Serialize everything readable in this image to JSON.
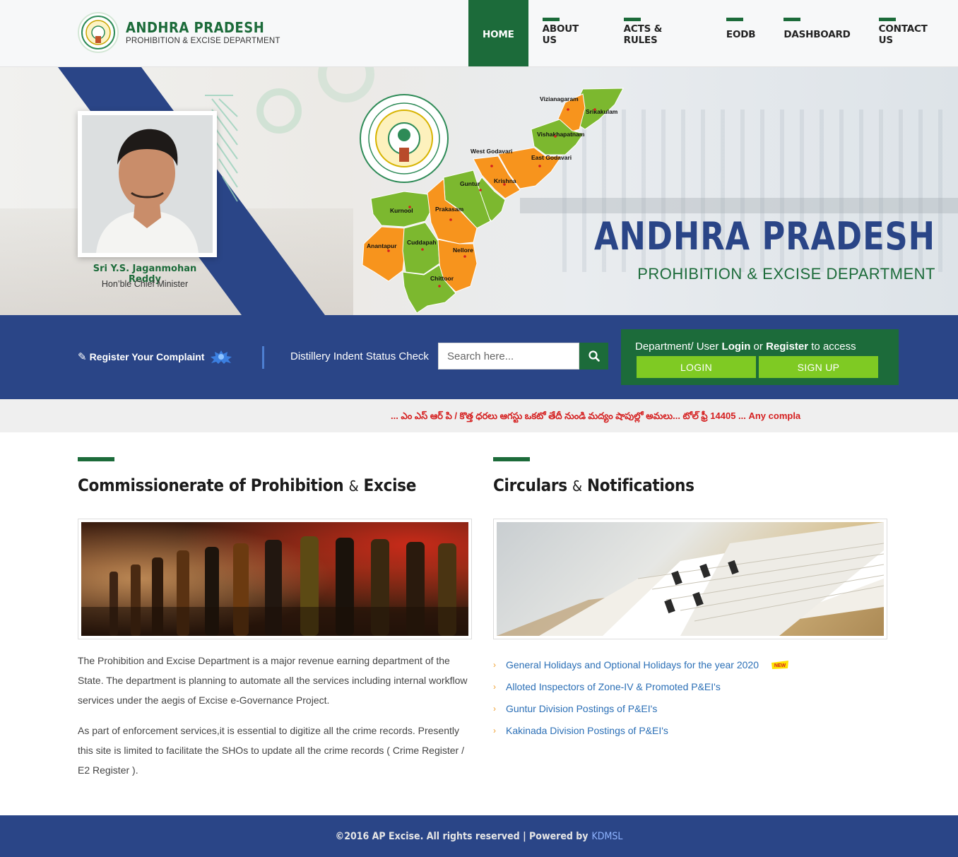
{
  "header": {
    "title": "ANDHRA PRADESH",
    "subtitle": "PROHIBITION & EXCISE DEPARTMENT",
    "nav": [
      {
        "label": "HOME",
        "active": true
      },
      {
        "label": "ABOUT US",
        "active": false
      },
      {
        "label": "ACTS & RULES",
        "active": false
      },
      {
        "label": "EODB",
        "active": false
      },
      {
        "label": "DASHBOARD",
        "active": false
      },
      {
        "label": "CONTACT US",
        "active": false
      }
    ]
  },
  "banner": {
    "cm_name": "Sri Y.S. Jaganmohan Reddy",
    "cm_role": "Hon’ble Chief Minister",
    "title": "ANDHRA PRADESH",
    "subtitle": "PROHIBITION & EXCISE DEPARTMENT",
    "districts": [
      "Vizianagaram",
      "Srikakulam",
      "Vishakhapatnam",
      "West Godavari",
      "East Godavari",
      "Guntur",
      "Krishna",
      "Kurnool",
      "Prakasam",
      "Anantapur",
      "Cuddapah",
      "Nellore",
      "Chittoor"
    ]
  },
  "actions": {
    "complaint_label": "Register Your Complaint",
    "distillery_label": "Distillery Indent Status Check",
    "search_placeholder": "Search here...",
    "login_prefix": "Department/ User ",
    "login_word": "Login",
    "login_or": " or ",
    "register_word": "Register",
    "login_suffix": " to access",
    "login_button": "LOGIN",
    "signup_button": "SIGN UP"
  },
  "marquee": {
    "text": "... ఎం ఎస్ ఆర్ పి / కొత్త ధరలు ఆగస్టు ఒకటో తేదీ నుండి మద్యం షాపుల్లో అమలు... టోల్ ఫ్రీ 14405 ... Any compla"
  },
  "left_section": {
    "title_a": "Commissionerate of Prohibition ",
    "title_amp": "&",
    "title_b": " Excise",
    "para1": "The Prohibition and Excise Department is a major revenue earning department of the State. The department is planning to automate all the services including internal workflow services under the aegis of Excise e-Governance Project.",
    "para2": "As part of enforcement services,it is essential to digitize all the crime records. Presently this site is limited to facilitate the SHOs to update all the crime records ( Crime Register / E2 Register )."
  },
  "right_section": {
    "title_a": "Circulars ",
    "title_amp": "&",
    "title_b": " Notifications",
    "items": [
      {
        "label": "General Holidays and Optional Holidays for the year 2020",
        "new": true
      },
      {
        "label": "Alloted Inspectors of Zone-IV & Promoted P&EI's",
        "new": false
      },
      {
        "label": "Guntur Division Postings of P&EI's",
        "new": false
      },
      {
        "label": "Kakinada Division Postings of P&EI's",
        "new": false
      }
    ],
    "new_badge": "NEW"
  },
  "footer": {
    "text": "©2016 AP Excise. All rights reserved | Powered by",
    "link": "KDMSL"
  },
  "colors": {
    "brand_green": "#1c6b3a",
    "brand_blue": "#2a4587",
    "button_green": "#7fca23",
    "map_orange": "#f7941d",
    "map_green": "#7cb82f",
    "marquee_red": "#d51f1f"
  }
}
